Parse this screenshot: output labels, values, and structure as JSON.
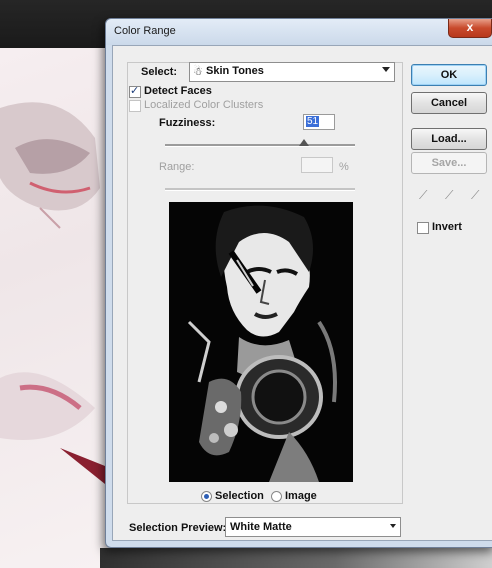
{
  "dialog": {
    "title": "Color Range",
    "close_glyph": "x"
  },
  "select": {
    "label": "Select:",
    "value": "Skin Tones",
    "icon": "eyedropper-figure-icon"
  },
  "options": {
    "detect_faces": {
      "label": "Detect Faces",
      "checked": true
    },
    "localized_color_clusters": {
      "label": "Localized Color Clusters",
      "checked": false,
      "enabled": false
    }
  },
  "fuzziness": {
    "label": "Fuzziness:",
    "value": "51"
  },
  "range": {
    "label": "Range:",
    "value": "",
    "unit": "%"
  },
  "preview_mode": {
    "selection_label": "Selection",
    "image_label": "Image",
    "selected": "Selection"
  },
  "selection_preview": {
    "label": "Selection Preview:",
    "value": "White Matte"
  },
  "buttons": {
    "ok": "OK",
    "cancel": "Cancel",
    "load": "Load...",
    "save": "Save..."
  },
  "invert": {
    "label": "Invert",
    "checked": false
  },
  "colors": {
    "close_red": "#c84a2c",
    "title_bar": "#cfdcec",
    "selection_blue": "#3b6fd8"
  }
}
